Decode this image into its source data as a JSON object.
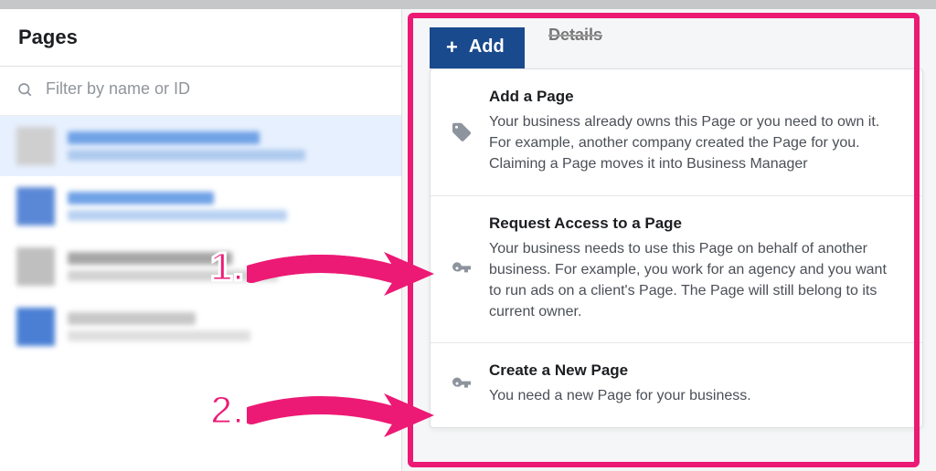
{
  "sidebar": {
    "title": "Pages",
    "searchPlaceholder": "Filter by name or ID"
  },
  "details": {
    "label": "Details"
  },
  "addButton": {
    "label": "Add"
  },
  "dropdown": {
    "items": [
      {
        "title": "Add a Page",
        "desc": "Your business already owns this Page or you need to own it. For example, another company created the Page for you. Claiming a Page moves it into Business Manager"
      },
      {
        "title": "Request Access to a Page",
        "desc": "Your business needs to use this Page on behalf of another business. For example, you work for an agency and you want to run ads on a client's Page. The Page will still belong to its current owner."
      },
      {
        "title": "Create a New Page",
        "desc": "You need a new Page for your business."
      }
    ]
  },
  "annotations": {
    "marker1": "1.",
    "marker2": "2."
  }
}
